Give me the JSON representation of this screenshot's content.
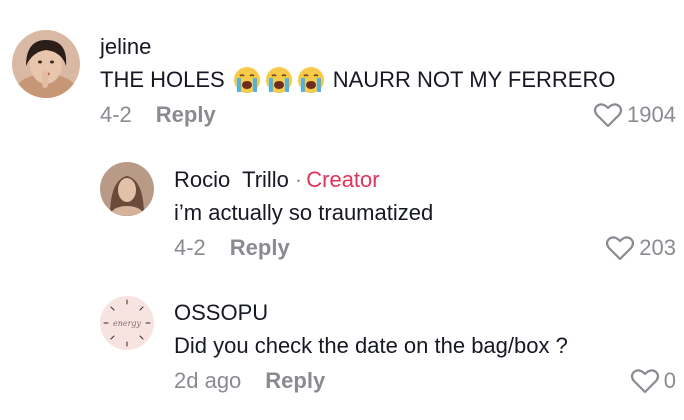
{
  "comments": [
    {
      "username": "jeline",
      "text_prefix": "THE HOLES",
      "emoji": [
        "loudly-crying-face",
        "loudly-crying-face",
        "loudly-crying-face"
      ],
      "text_suffix": "NAURR NOT MY FERRERO",
      "date": "4-2",
      "reply_label": "Reply",
      "likes": "1904"
    },
    {
      "username": "Rocio  Trillo",
      "separator": "·",
      "badge": "Creator",
      "text": "i’m actually so traumatized",
      "date": "4-2",
      "reply_label": "Reply",
      "likes": "203"
    },
    {
      "username": "OSSOPU",
      "text": "Did you check the date on the bag/box ?",
      "date": "2d ago",
      "reply_label": "Reply",
      "likes": "0",
      "avatar_text": "energy"
    }
  ],
  "colors": {
    "creator": "#e1335a",
    "meta": "#8a8b91",
    "text": "#161823"
  }
}
